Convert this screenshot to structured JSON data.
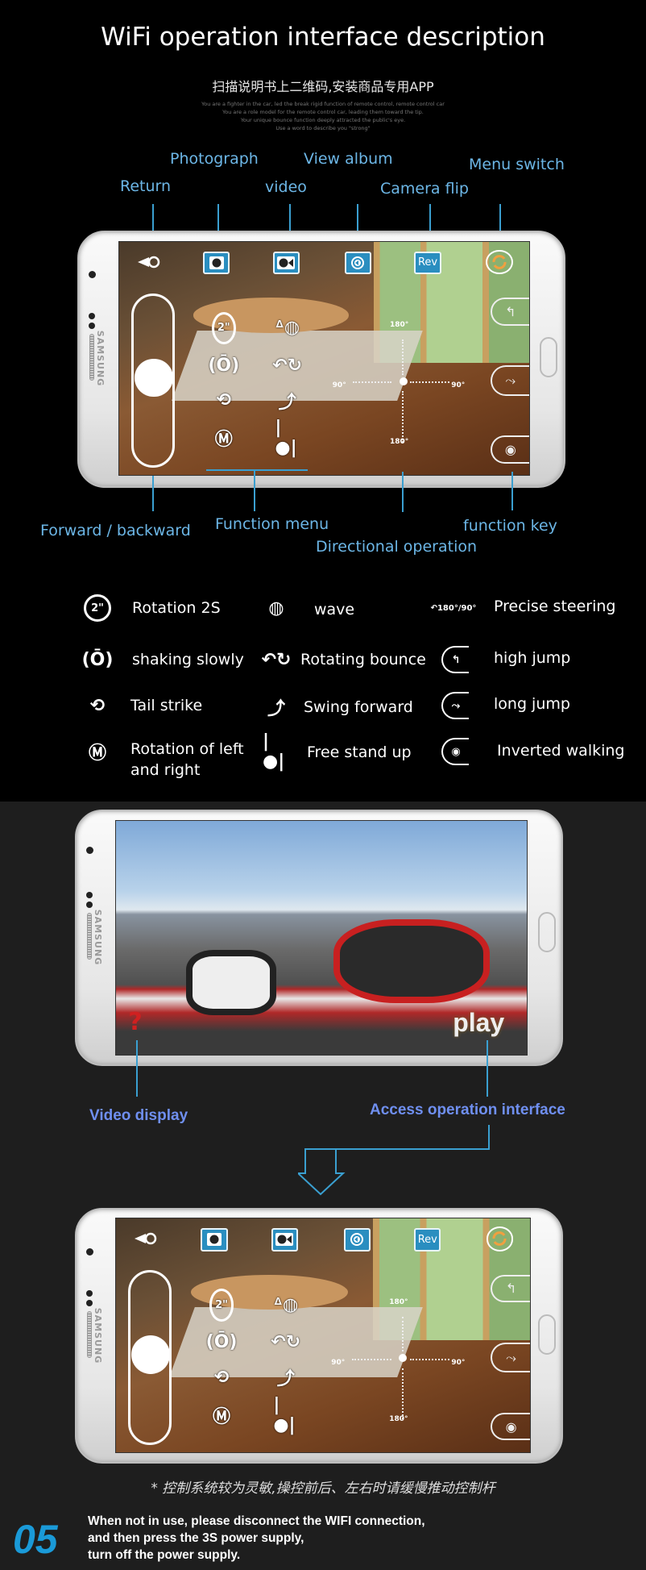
{
  "header": {
    "title": "WiFi operation interface description",
    "subtitle_cn": "扫描说明书上二维码,安装商品专用APP",
    "slogan_lines": [
      "You are a fighter in the car, led the break rigid function of remote control, remote control car",
      "You are a role model for the remote control car, leading them toward the tip.",
      "Your unique bounce function deeply attracted the public's eye.",
      "Use a word to describe you \"strong\""
    ]
  },
  "callouts_top": {
    "photograph": "Photograph",
    "view_album": "View album",
    "menu_switch": "Menu switch",
    "return": "Return",
    "video": "video",
    "camera_flip": "Camera flip"
  },
  "callouts_bottom": {
    "forward_backward": "Forward / backward",
    "function_menu": "Function menu",
    "directional": "Directional operation",
    "function_key": "function key"
  },
  "control_ui": {
    "rev_label": "Rev",
    "timer_label": "2\"",
    "deg_180": "180°",
    "deg_90": "90°"
  },
  "legend": {
    "col1": [
      {
        "icon": "rotation-2s-icon",
        "label": "Rotation 2S"
      },
      {
        "icon": "shaking-slowly-icon",
        "label": "shaking slowly"
      },
      {
        "icon": "tail-strike-icon",
        "label": "Tail strike"
      },
      {
        "icon": "rotation-left-right-icon",
        "label": "Rotation of left",
        "label2": "and right"
      }
    ],
    "col2": [
      {
        "icon": "wave-icon",
        "label": "wave"
      },
      {
        "icon": "rotating-bounce-icon",
        "label": "Rotating bounce"
      },
      {
        "icon": "swing-forward-icon",
        "label": "Swing forward"
      },
      {
        "icon": "free-stand-up-icon",
        "label": "Free stand up"
      }
    ],
    "col3": [
      {
        "icon": "precise-steering-icon",
        "label": "Precise steering"
      },
      {
        "icon": "high-jump-icon",
        "label": "high jump"
      },
      {
        "icon": "long-jump-icon",
        "label": "long jump"
      },
      {
        "icon": "inverted-walking-icon",
        "label": "Inverted walking"
      }
    ]
  },
  "video_screen": {
    "play_label": "play",
    "help_icon": "?",
    "video_display": "Video display",
    "access_interface": "Access operation interface"
  },
  "phone_brand": "SAMSUNG",
  "footer": {
    "note_cn": "* 控制系统较为灵敏,操控前后、左右时请缓慢推动控制杆",
    "step_number": "05",
    "lines": [
      "When not in use, please disconnect the WIFI connection,",
      "and then press the 3S power supply,",
      "turn off the power supply."
    ]
  },
  "colors": {
    "callout": "#6cb6e6",
    "callout_blue": "#6f8ff0",
    "button": "#2a8ec0",
    "step_number": "#1a9ad8"
  }
}
